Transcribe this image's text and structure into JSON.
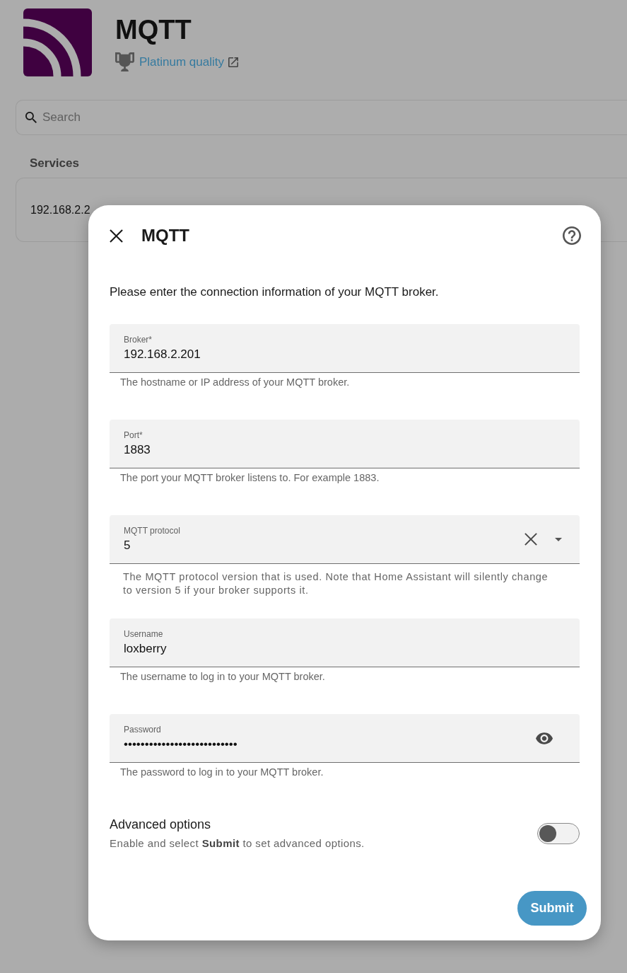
{
  "page": {
    "header": {
      "title": "MQTT",
      "quality_link": "Platinum quality"
    },
    "search": {
      "placeholder": "Search"
    },
    "services": {
      "heading": "Services",
      "items": [
        {
          "label": "192.168.2.2"
        }
      ]
    }
  },
  "dialog": {
    "title": "MQTT",
    "description": "Please enter the connection information of your MQTT broker.",
    "fields": [
      {
        "kind": "text",
        "label": "Broker*",
        "value": "192.168.2.201",
        "helper": "The hostname or IP address of your MQTT broker."
      },
      {
        "kind": "text",
        "label": "Port*",
        "value": "1883",
        "helper": "The port your MQTT broker listens to. For example 1883."
      },
      {
        "kind": "select",
        "label": "MQTT protocol",
        "value": "5",
        "helper": "The MQTT protocol version that is used. Note that Home Assistant will silently change to version 5 if your broker supports it."
      },
      {
        "kind": "text",
        "label": "Username",
        "value": "loxberry",
        "helper": "The username to log in to your MQTT broker."
      },
      {
        "kind": "password",
        "label": "Password",
        "value": "•••••••••••••••••••••••••••",
        "helper": "The password to log in to your MQTT broker."
      }
    ],
    "advanced": {
      "title": "Advanced options",
      "description": "Enable and select **Submit** to set advanced options.",
      "on": false
    },
    "submit": {
      "label": "Submit"
    }
  }
}
